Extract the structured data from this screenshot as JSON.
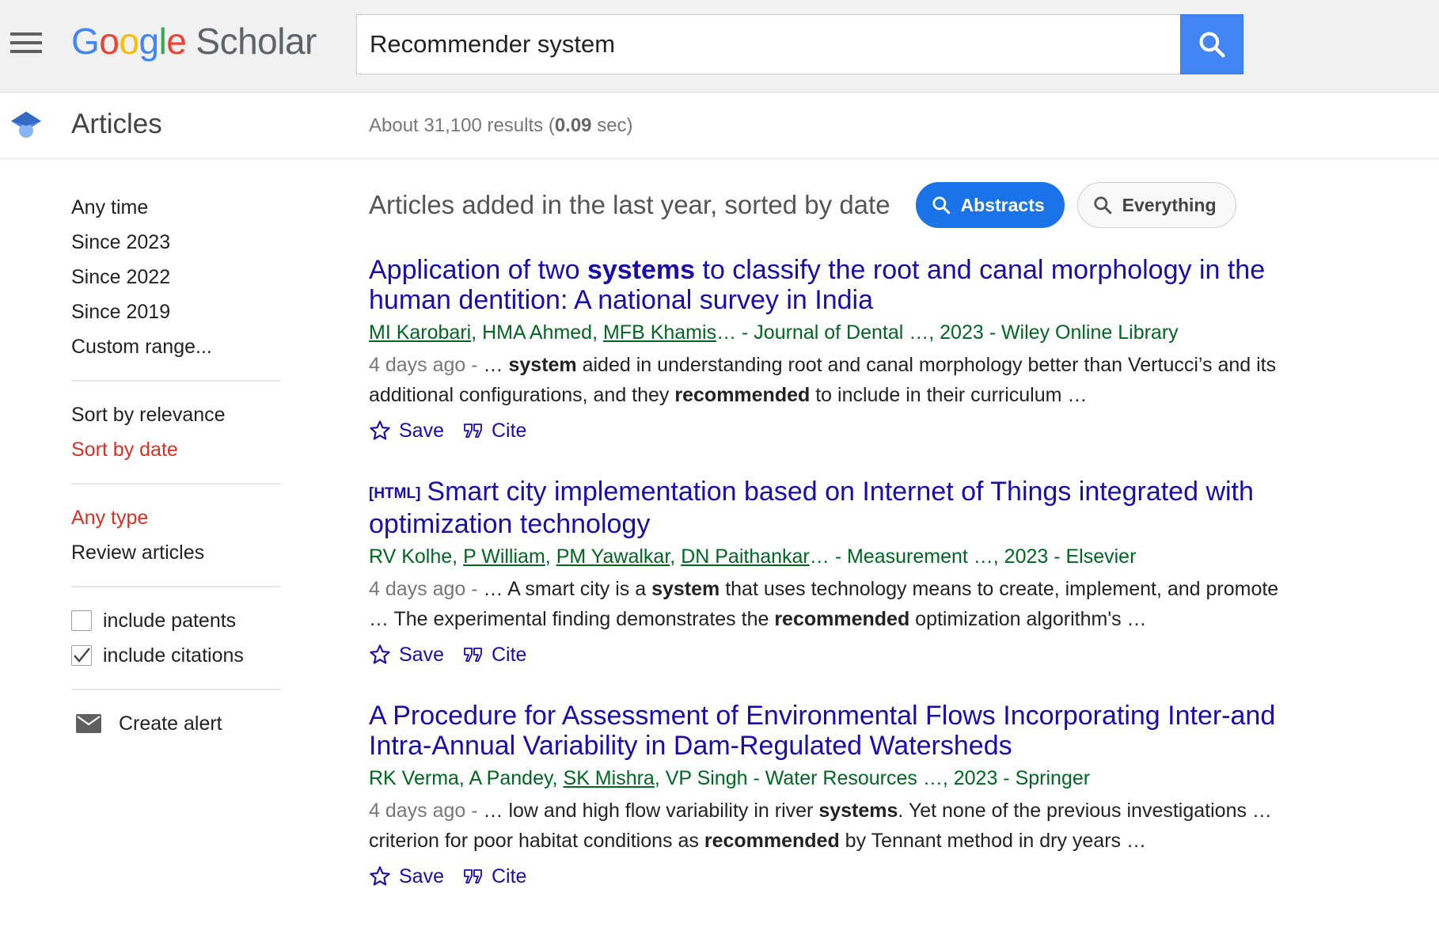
{
  "header": {
    "logo_google": [
      "G",
      "o",
      "o",
      "g",
      "l",
      "e"
    ],
    "logo_scholar": "Scholar",
    "search_query": "Recommender system"
  },
  "subheader": {
    "section": "Articles",
    "results_prefix": "About 31,100 results (",
    "results_time": "0.09",
    "results_suffix": " sec)"
  },
  "sidebar": {
    "time_filters": [
      "Any time",
      "Since 2023",
      "Since 2022",
      "Since 2019",
      "Custom range..."
    ],
    "sort": [
      "Sort by relevance",
      "Sort by date"
    ],
    "type": [
      "Any type",
      "Review articles"
    ],
    "include_patents": "include patents",
    "include_citations": "include citations",
    "create_alert": "Create alert"
  },
  "main": {
    "filter_title": "Articles added in the last year, sorted by date",
    "abstracts_label": "Abstracts",
    "everything_label": "Everything",
    "save_label": "Save",
    "cite_label": "Cite",
    "results": [
      {
        "title_pre": "Application of two ",
        "title_bold": "systems",
        "title_post": " to classify the root and canal morphology in the human dentition: A national survey in India",
        "authors": [
          "MI Karobari",
          "HMA Ahmed",
          "MFB Khamis"
        ],
        "author_sep": ", ",
        "meta_tail": "… - Journal of Dental …, 2023 - Wiley Online Library",
        "age": "4 days ago - ",
        "snippet_1": "… ",
        "snippet_b1": "system",
        "snippet_2": " aided in understanding root and canal morphology better than Vertucci’s and its additional configurations, and they ",
        "snippet_b2": "recommended",
        "snippet_3": " to include in their curriculum …"
      },
      {
        "tag": "[HTML]",
        "title": "Smart city implementation based on Internet of Things integrated with optimization technology",
        "author_plain": "RV Kolhe, ",
        "authors": [
          "P William",
          "PM Yawalkar",
          "DN Paithankar"
        ],
        "author_sep": ", ",
        "meta_tail": "… - Measurement …, 2023 - Elsevier",
        "age": "4 days ago - ",
        "snippet_1": "… A smart city is a ",
        "snippet_b1": "system",
        "snippet_2": " that uses technology means to create, implement, and promote … The experimental finding demonstrates the ",
        "snippet_b2": "recommended",
        "snippet_3": " optimization algorithm's …"
      },
      {
        "title": "A Procedure for Assessment of Environmental Flows Incorporating Inter-and Intra-Annual Variability in Dam-Regulated Watersheds",
        "author_plain": "RK Verma, A Pandey, ",
        "author_link": "SK Mishra",
        "meta_tail": ", VP Singh - Water Resources …, 2023 - Springer",
        "age": "4 days ago - ",
        "snippet_1": "… low and high flow variability in river ",
        "snippet_b1": "systems",
        "snippet_2": ". Yet none of the previous investigations … criterion for poor habitat conditions as ",
        "snippet_b2": "recommended",
        "snippet_3": " by Tennant method in dry years …"
      }
    ]
  },
  "colors": {
    "link": "#1a0dab",
    "meta_green": "#006621",
    "active_red": "#d93025",
    "brand_blue": "#4285f4"
  }
}
